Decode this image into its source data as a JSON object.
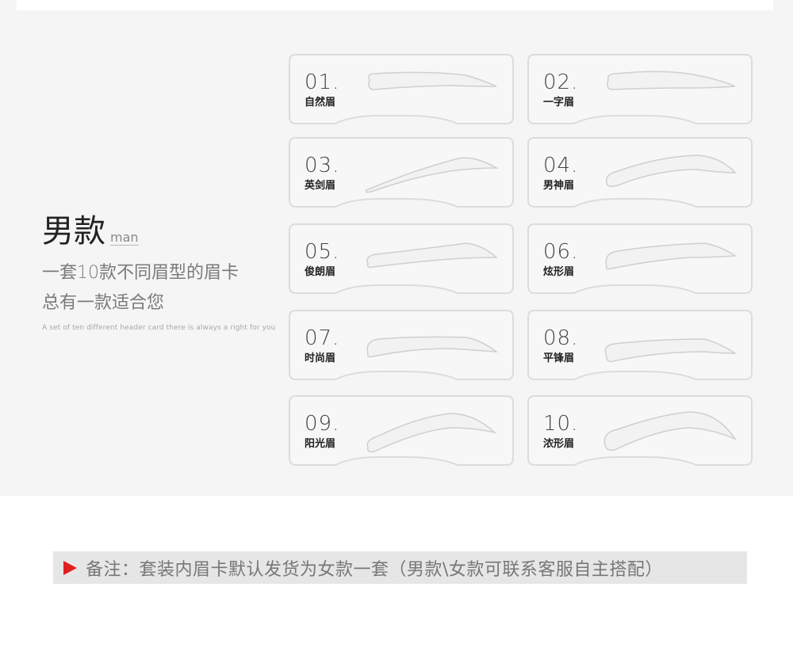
{
  "header": {
    "title": "男款",
    "subtitle": "man",
    "description_line1": "一套10款不同眉型的眉卡",
    "description_line2": "总有一款适合您",
    "tagline": "A set of ten different header card there is always a right for you"
  },
  "cards": [
    {
      "number": "01.",
      "name": "自然眉"
    },
    {
      "number": "02.",
      "name": "一字眉"
    },
    {
      "number": "03.",
      "name": "英剑眉"
    },
    {
      "number": "04.",
      "name": "男神眉"
    },
    {
      "number": "05.",
      "name": "俊朗眉"
    },
    {
      "number": "06.",
      "name": "炫形眉"
    },
    {
      "number": "07.",
      "name": "时尚眉"
    },
    {
      "number": "08.",
      "name": "平锋眉"
    },
    {
      "number": "09.",
      "name": "阳光眉"
    },
    {
      "number": "10.",
      "name": "浓形眉"
    }
  ],
  "note": {
    "text": "备注：套装内眉卡默认发货为女款一套（男款\\女款可联系客服自主搭配）"
  },
  "colors": {
    "panel": "#f5f5f5",
    "note_bg": "#e6e6e6",
    "arrow": "#e02020"
  }
}
